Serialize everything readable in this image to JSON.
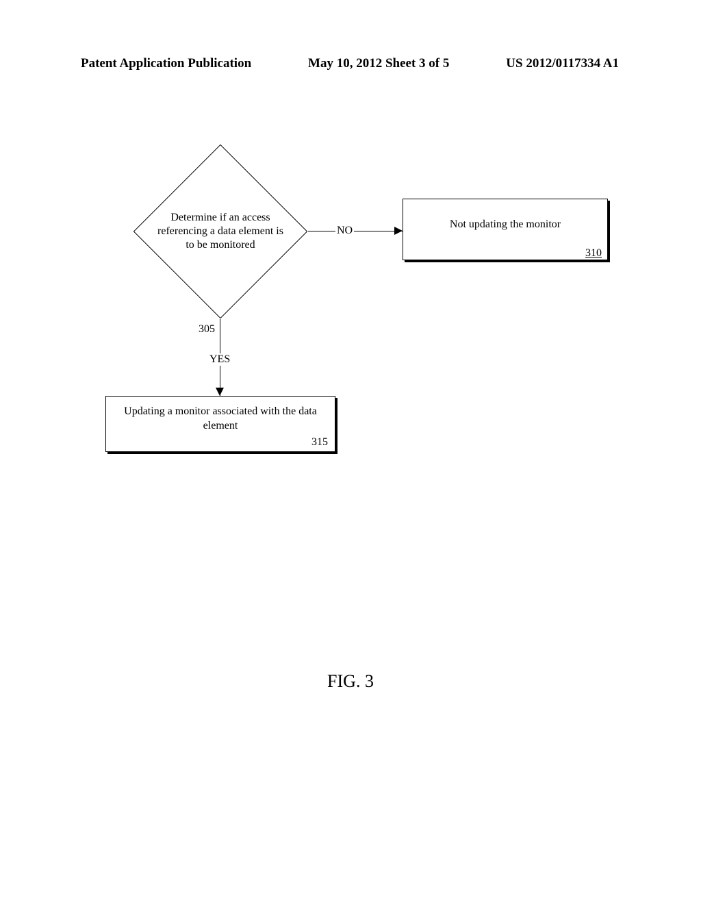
{
  "header": {
    "left": "Patent Application Publication",
    "center": "May 10, 2012  Sheet 3 of 5",
    "right": "US 2012/0117334 A1"
  },
  "chart_data": {
    "type": "flowchart",
    "nodes": [
      {
        "id": "305",
        "shape": "diamond",
        "text": "Determine if an access referencing a data element is to be monitored",
        "ref": "305"
      },
      {
        "id": "310",
        "shape": "rect",
        "text": "Not updating the monitor",
        "ref": "310"
      },
      {
        "id": "315",
        "shape": "rect",
        "text": "Updating a monitor associated with the data element",
        "ref": "315"
      }
    ],
    "edges": [
      {
        "from": "305",
        "to": "310",
        "label": "NO"
      },
      {
        "from": "305",
        "to": "315",
        "label": "YES"
      }
    ]
  },
  "labels": {
    "no": "NO",
    "yes": "YES"
  },
  "figure": "FIG. 3"
}
